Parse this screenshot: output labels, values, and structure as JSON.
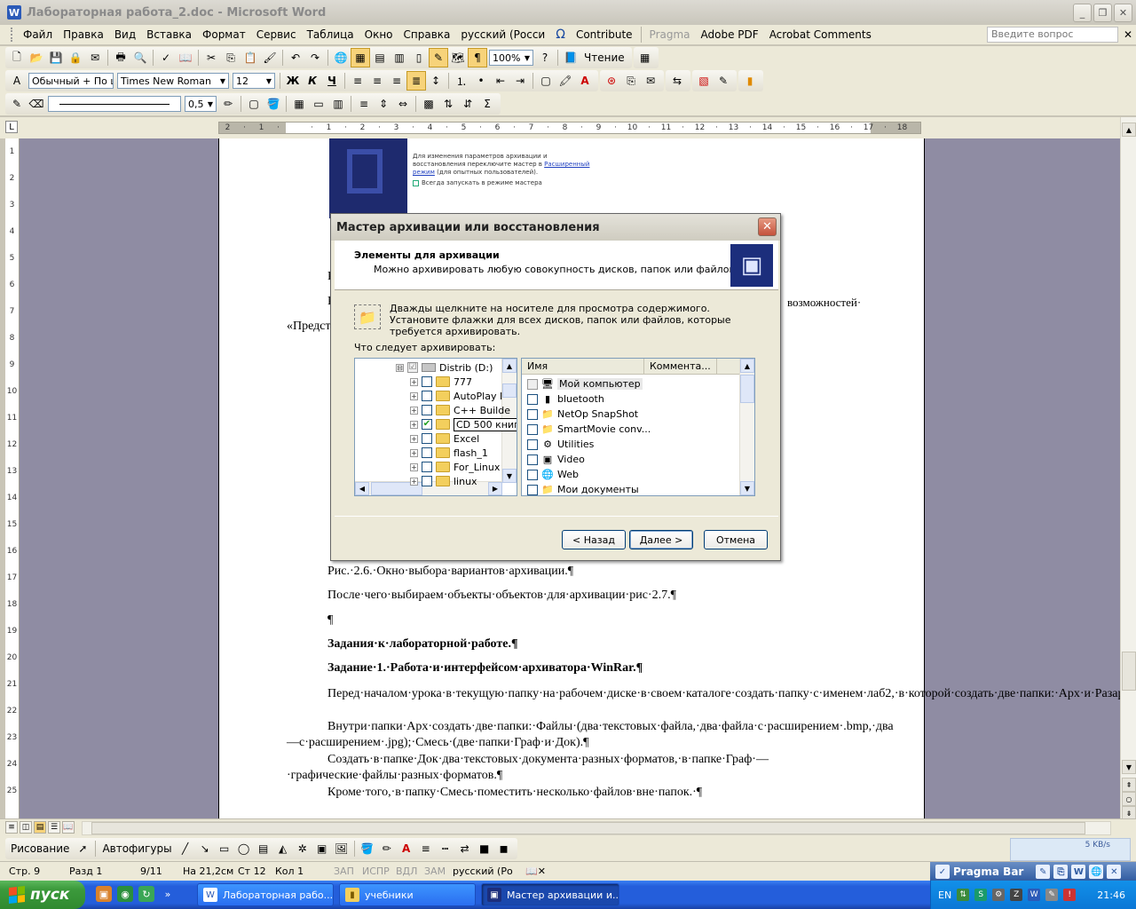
{
  "window": {
    "title": "Лабораторная работа_2.doc - Microsoft Word",
    "app_icon": "W"
  },
  "menu": {
    "items": [
      "Файл",
      "Правка",
      "Вид",
      "Вставка",
      "Формат",
      "Сервис",
      "Таблица",
      "Окно",
      "Справка",
      "русский (Росси",
      "Contribute",
      "Pragma",
      "Adobe PDF",
      "Acrobat Comments"
    ],
    "help_placeholder": "Введите вопрос",
    "omega": "Ω"
  },
  "toolbar": {
    "zoom": "100%",
    "reading_label": "Чтение",
    "style": "Обычный + По ц",
    "font": "Times New Roman",
    "font_size": "12",
    "line_weight": "0,5",
    "bold": "Ж",
    "italic": "К",
    "underline": "Ч",
    "paragraph_mark": "¶",
    "sum": "Σ"
  },
  "ruler": {
    "ticks": [
      "2",
      "·",
      "1",
      "·",
      "",
      "·",
      "1",
      "·",
      "2",
      "·",
      "3",
      "·",
      "4",
      "·",
      "5",
      "·",
      "6",
      "·",
      "7",
      "·",
      "8",
      "·",
      "9",
      "·",
      "10",
      "·",
      "11",
      "·",
      "12",
      "·",
      "13",
      "·",
      "14",
      "·",
      "15",
      "·",
      "16",
      "·",
      "17",
      "·",
      "18"
    ],
    "vertical": [
      "1",
      "2",
      "3",
      "4",
      "5",
      "6",
      "7",
      "8",
      "9",
      "10",
      "11",
      "12",
      "13",
      "14",
      "15",
      "16",
      "17",
      "18",
      "19",
      "20",
      "21",
      "22",
      "23",
      "24",
      "25"
    ]
  },
  "document": {
    "embedded_info": "Для изменения параметров архивации и восстановления переключите мастер в",
    "embedded_link": "Расширенный режим",
    "embedded_info_tail": "(для опытных пользователей).",
    "embedded_check": "Всегда запускать в режиме мастера",
    "peek_left_1": "Р",
    "peek_left_2": "Р",
    "peek_right": "возможностей·",
    "peek_quote": "«Предст",
    "caption": "Рис.·2.6.·Окно·выбора·вариантов·архивации.¶",
    "after_text": "После·чего·выбираем·объекты·объектов·для·архивации·рис·2.7.¶",
    "empty_para": "¶",
    "heading1": "Задания·к·лабораторной·работе.¶",
    "heading2": "Задание·1.·Работа·и·интерфейсом·архиватора·WinRar.¶",
    "para1": "Перед·началом·урока·в·текущую·папку·на·рабочем·диске·в·своем·каталоге·создать·папку·с·именем·лаб2,·в·которой·создать·две·папки:·Арх·и·Разарх.¶",
    "para2": "Внутри·папки·Арх·создать·две·папки:·Файлы·(два·текстовых·файла,·два·файла·с·расширением·.bmp,·два—с·расширением·.jpg);·Смесь·(две·папки·Граф·и·Док).¶",
    "para3": "Создать·в·папке·Док·два·текстовых·документа·разных·форматов,·в·папке·Граф·—·графические·файлы·разных·форматов.¶",
    "para4": "Кроме·того,·в·папку·Смесь·поместить·несколько·файлов·вне·папок.·¶"
  },
  "dialog": {
    "title": "Мастер архивации или восстановления",
    "heading": "Элементы для архивации",
    "subheading": "Можно архивировать любую совокупность дисков, папок или файлов.",
    "instruction": "Дважды щелкните на носителе для просмотра содержимого. Установите флажки для всех дисков, папок или файлов, которые требуется архивировать.",
    "what_label": "Что следует архивировать:",
    "tree": [
      {
        "label": "Distrib (D:)",
        "checked": "☑",
        "expander": "⊟"
      },
      {
        "label": "777",
        "checked": "",
        "expander": "+"
      },
      {
        "label": "AutoPlay I",
        "checked": "",
        "expander": "+"
      },
      {
        "label": "C++ Builde",
        "checked": "",
        "expander": "+"
      },
      {
        "label": "CD 500 книг",
        "checked": "✔",
        "expander": "+"
      },
      {
        "label": "Excel",
        "checked": "",
        "expander": "+"
      },
      {
        "label": "flash_1",
        "checked": "",
        "expander": "+"
      },
      {
        "label": "For_Linux",
        "checked": "",
        "expander": "+"
      },
      {
        "label": "linux",
        "checked": "",
        "expander": "+"
      }
    ],
    "list_headers": [
      "Имя",
      "Коммента..."
    ],
    "list": [
      {
        "label": "Мой компьютер",
        "icon": "🖥"
      },
      {
        "label": "bluetooth",
        "icon": "▮"
      },
      {
        "label": "NetOp SnapShot",
        "icon": "📁"
      },
      {
        "label": "SmartMovie conv...",
        "icon": "📁"
      },
      {
        "label": "Utilities",
        "icon": "⚙"
      },
      {
        "label": "Video",
        "icon": "▣"
      },
      {
        "label": "Web",
        "icon": "🌐"
      },
      {
        "label": "Мои документы",
        "icon": "📁"
      }
    ],
    "back": "< Назад",
    "next": "Далее >",
    "cancel": "Отмена"
  },
  "drawing": {
    "draw_label": "Рисование",
    "autoshapes_label": "Автофигуры",
    "net_speed": "5 KB/s"
  },
  "status": {
    "page": "Стр. 9",
    "section": "Разд 1",
    "pages": "9/11",
    "position": "На 21,2см",
    "line": "Ст 12",
    "column": "Кол 1",
    "rec": "ЗАП",
    "trk": "ИСПР",
    "ext": "ВДЛ",
    "ovr": "ЗАМ",
    "language": "русский (Ро",
    "pragma_bar": "Pragma Bar"
  },
  "taskbar": {
    "start": "пуск",
    "tasks": [
      "Лабораторная рабо...",
      "учебники",
      "Мастер архивации и..."
    ],
    "language": "EN",
    "clock": "21:46",
    "chevron": "»"
  },
  "colors": {
    "dialog_header_icon": "#1c2e7c",
    "taskbar": "#245edb",
    "start": "#3c9a3c"
  }
}
